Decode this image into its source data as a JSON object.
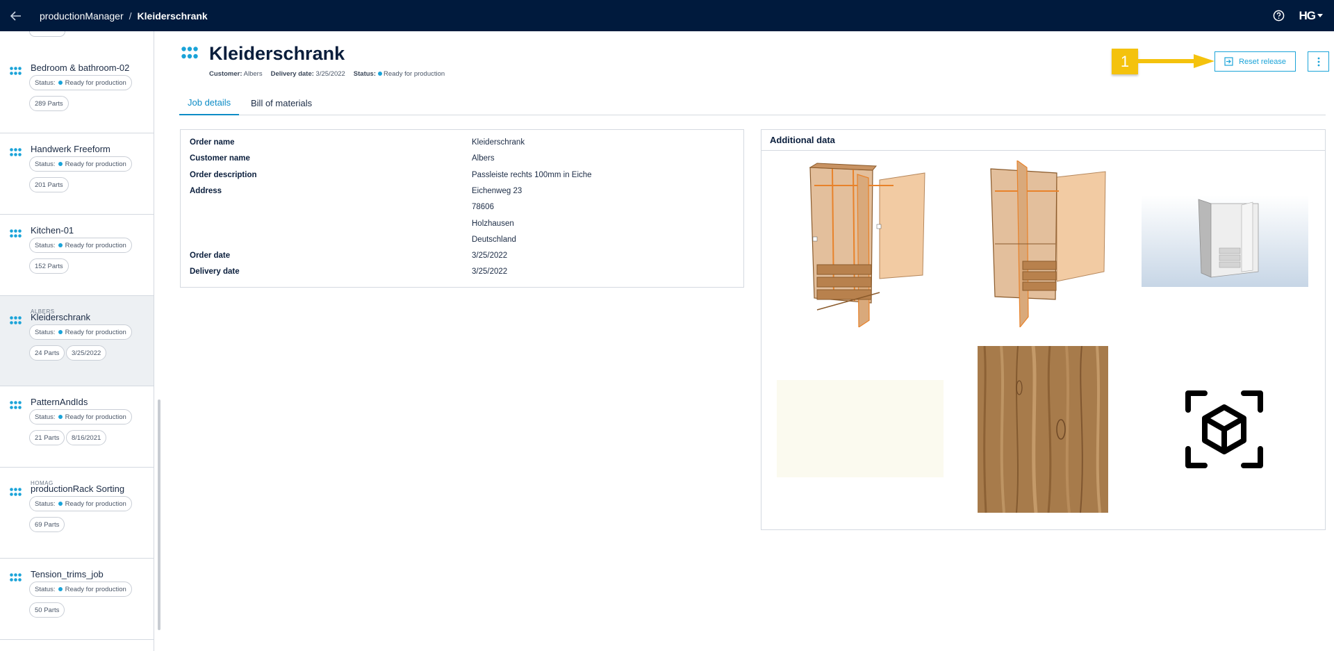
{
  "topbar": {
    "app_name": "productionManager",
    "separator": "/",
    "current": "Kleiderschrank",
    "back_icon": "arrow-left-icon",
    "help_icon": "help-circle-icon",
    "logo_text": "HG"
  },
  "sidebar": {
    "jobs": [
      {
        "name": "Bedroom & bathroom-02",
        "customer": "",
        "status_label": "Status:",
        "status": "Ready for production",
        "parts": "289 Parts",
        "date": ""
      },
      {
        "name": "Handwerk Freeform",
        "customer": "",
        "status_label": "Status:",
        "status": "Ready for production",
        "parts": "201 Parts",
        "date": ""
      },
      {
        "name": "Kitchen-01",
        "customer": "",
        "status_label": "Status:",
        "status": "Ready for production",
        "parts": "152 Parts",
        "date": ""
      },
      {
        "name": "Kleiderschrank",
        "customer": "ALBERS",
        "status_label": "Status:",
        "status": "Ready for production",
        "parts": "24 Parts",
        "date": "3/25/2022"
      },
      {
        "name": "PatternAndIds",
        "customer": "",
        "status_label": "Status:",
        "status": "Ready for production",
        "parts": "21 Parts",
        "date": "8/16/2021"
      },
      {
        "name": "productionRack Sorting",
        "customer": "HOMAG",
        "status_label": "Status:",
        "status": "Ready for production",
        "parts": "69 Parts",
        "date": ""
      },
      {
        "name": "Tension_trims_job",
        "customer": "",
        "status_label": "Status:",
        "status": "Ready for production",
        "parts": "50 Parts",
        "date": ""
      }
    ]
  },
  "header": {
    "title": "Kleiderschrank",
    "customer_label": "Customer:",
    "customer": "Albers",
    "delivery_label": "Delivery date:",
    "delivery": "3/25/2022",
    "status_label": "Status:",
    "status": "Ready for production",
    "reset_button": "Reset release",
    "annotation_number": "1"
  },
  "tabs": [
    {
      "label": "Job details",
      "active": true
    },
    {
      "label": "Bill of materials",
      "active": false
    }
  ],
  "details": [
    {
      "label": "Order name",
      "value": "Kleiderschrank"
    },
    {
      "label": "Customer name",
      "value": "Albers"
    },
    {
      "label": "Order description",
      "value": "Passleiste rechts 100mm in Eiche"
    },
    {
      "label": "Address",
      "value": "Eichenweg 23"
    },
    {
      "label": "",
      "value": "78606"
    },
    {
      "label": "",
      "value": "Holzhausen"
    },
    {
      "label": "",
      "value": "Deutschland"
    },
    {
      "label": "Order date",
      "value": "3/25/2022"
    },
    {
      "label": "Delivery date",
      "value": "3/25/2022"
    }
  ],
  "additional": {
    "title": "Additional data",
    "images": [
      "exploded-wardrobe-drawing",
      "wardrobe-drawing",
      "wardrobe-3d-render",
      "cream-material-swatch",
      "oak-wood-texture",
      "3d-model-icon"
    ]
  },
  "colors": {
    "topbar": "#001a3d",
    "accent": "#1aa3d8",
    "annotation": "#f4c20d"
  }
}
